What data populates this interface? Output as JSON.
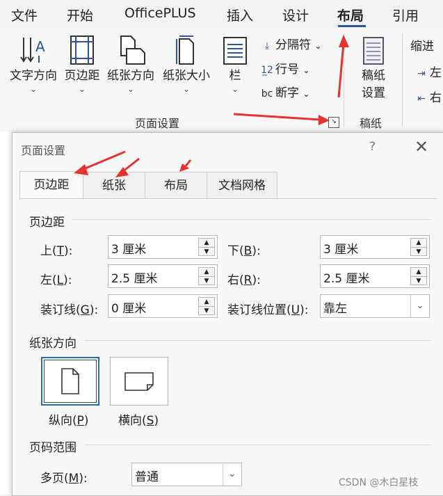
{
  "ribbon": {
    "tabs": [
      "文件",
      "开始",
      "OfficePLUS",
      "插入",
      "设计",
      "布局",
      "引用"
    ],
    "active_tab": "布局",
    "buttons": {
      "text_direction": "文字方向",
      "margins": "页边距",
      "orientation": "纸张方向",
      "size": "纸张大小",
      "columns": "栏",
      "breaks": "分隔符",
      "line_numbers": "行号",
      "hyphenation": "断字",
      "draft_paper": "稿纸设置",
      "draft_paper_line2": "设置",
      "draft_paper_line1": "稿纸",
      "indent": "缩进",
      "indent_left": "左",
      "indent_right": "右"
    },
    "groups": {
      "page_setup": "页面设置",
      "draft": "稿纸"
    },
    "accent_color": "#2b579a"
  },
  "dialog": {
    "title": "页面设置",
    "help": "?",
    "close": "✕",
    "tabs": [
      "页边距",
      "纸张",
      "布局",
      "文档网格"
    ],
    "active_tab": "页边距",
    "margins_section": "页边距",
    "fields": {
      "top": {
        "label": "上(",
        "key": "T",
        "tail": "):",
        "value": "3 厘米"
      },
      "bottom": {
        "label": "下(",
        "key": "B",
        "tail": "):",
        "value": "3 厘米"
      },
      "left": {
        "label": "左(",
        "key": "L",
        "tail": "):",
        "value": "2.5 厘米"
      },
      "right": {
        "label": "右(",
        "key": "R",
        "tail": "):",
        "value": "2.5 厘米"
      },
      "gutter": {
        "label": "装订线(",
        "key": "G",
        "tail": "):",
        "value": "0 厘米"
      },
      "gutter_pos": {
        "label": "装订线位置(",
        "key": "U",
        "tail": "):",
        "value": "靠左"
      }
    },
    "orientation_section": "纸张方向",
    "portrait": {
      "label": "纵向(",
      "key": "P",
      "tail": ")"
    },
    "landscape": {
      "label": "横向(",
      "key": "S",
      "tail": ")"
    },
    "pages_section": "页码范围",
    "multiple_pages": {
      "label": "多页(",
      "key": "M",
      "tail": "):",
      "value": "普通"
    }
  },
  "watermark": "CSDN @木白星枝",
  "annotation_color": "#e8322f"
}
